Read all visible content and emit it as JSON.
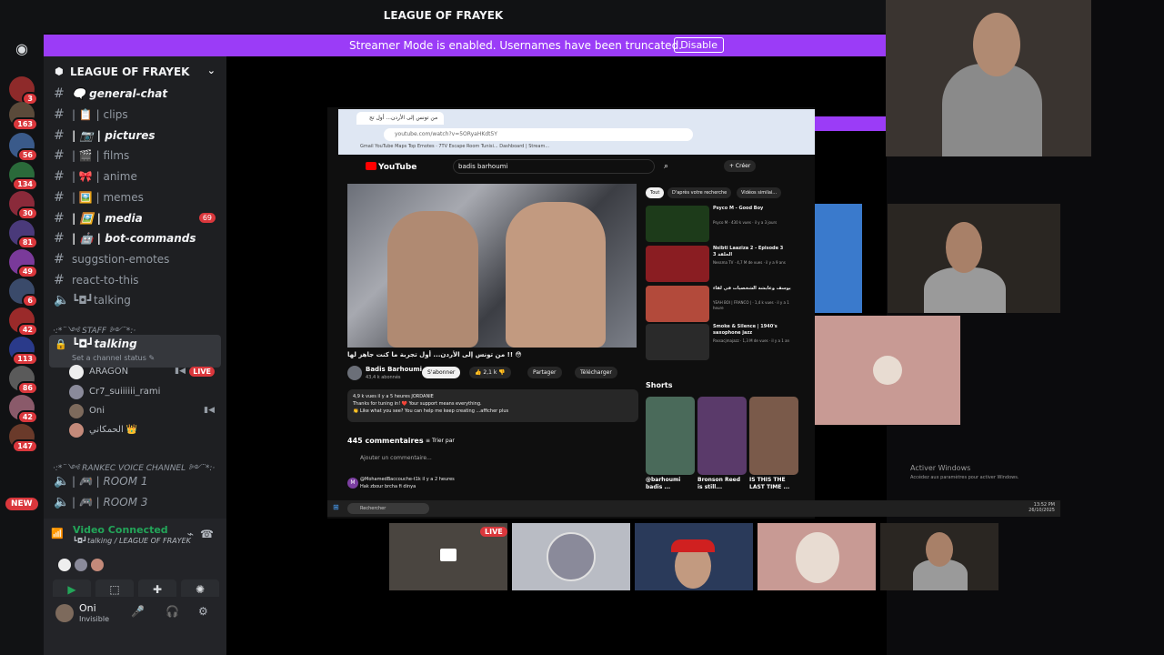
{
  "window": {
    "title": "LEAGUE OF FRAYEK"
  },
  "streamer_banner": {
    "message": "Streamer Mode is enabled. Usernames have been truncated.",
    "button": "Disable"
  },
  "rail": {
    "badges": [
      "3",
      "163",
      "56",
      "134",
      "30",
      "81",
      "49",
      "6",
      "42",
      "113",
      "86",
      "42",
      "147"
    ],
    "new_label": "NEW"
  },
  "server": {
    "name": "LEAGUE OF FRAYEK"
  },
  "channels": [
    {
      "name": "🗨️ general-chat",
      "bold": true
    },
    {
      "name": "| 📋 | clips",
      "bold": false
    },
    {
      "name": "| 📷 | pictures",
      "bold": true
    },
    {
      "name": "| 🎬 | films",
      "bold": false
    },
    {
      "name": "| 🎀 | anime",
      "bold": false
    },
    {
      "name": "| 🖼️ | memes",
      "bold": false
    },
    {
      "name": "| 🖼️ | media",
      "bold": true,
      "count": "69"
    },
    {
      "name": "| 🤖 | bot-commands",
      "bold": true
    },
    {
      "name": "suggstion-emotes",
      "bold": false
    },
    {
      "name": "react-to-this",
      "bold": false
    },
    {
      "name": "┗◘┛talking",
      "bold": false
    }
  ],
  "categories": {
    "staff": "·:*¨༺ STAFF ༻¨*:·",
    "voice": "·:*¨༺ RANKEC VOICE CHANNEL ༻¨*:·"
  },
  "selected_channel": {
    "name": "┗◘┛talking",
    "status": "Set a channel status ✎"
  },
  "voice_users": [
    {
      "name": "ARAGON",
      "live": "LIVE"
    },
    {
      "name": "Cr7_suiiiiii_rami"
    },
    {
      "name": "Oni"
    },
    {
      "name": "الحمكاني 👑"
    }
  ],
  "voice_channels": [
    "| 🎮 | ROOM 1",
    "| 🎮 | ROOM 3"
  ],
  "voice_connection": {
    "status": "Video Connected",
    "channel": "┗◘┛talking / LEAGUE OF FRAYEK"
  },
  "me": {
    "name": "Oni",
    "status": "Invisible"
  },
  "browser": {
    "tab_title": "من تونس إلى الأردن... أول تج",
    "url": "youtube.com/watch?v=5ORyaHKdt5Y",
    "bookmarks": "Gmail    YouTube    Maps    Top Emotes · 7TV    Escape Room Tunisi...    Dashboard | Stream..."
  },
  "youtube": {
    "search_query": "badis barhoumi",
    "create": "+ Créer",
    "video_title": "من تونس إلى الأردن... أول تجربة ما كنت جاهز لها !! 😳",
    "channel_name": "Badis Barhoumi",
    "channel_subs": "43,4 k abonnés",
    "subscribe": "S'abonner",
    "likes": "2,1 k",
    "share": "Partager",
    "download": "Télécharger",
    "description_line1": "4,9 k vues  il y a 5 heures  JORDANIE",
    "description_line2": "Thanks for tuning in! ❤️ Your support means everything.",
    "description_line3": "👏 Like what you see? You can help me keep creating ...afficher plus",
    "comments_count": "445 commentaires",
    "sort": "Trier par",
    "add_comment": "Ajouter un commentaire...",
    "comment_author": "@MohamedBaccouche-t1k  il y a 2 heures",
    "comment_text": "Hak zbour brcha fi dinya",
    "chips": [
      "Tout",
      "D'après votre recherche",
      "Vidéos similai..."
    ],
    "recommendations": [
      {
        "title": "Psyco M - Good Boy",
        "meta": "Psyco M · 430 k vues · il y a 3 jours",
        "color": "#1d3b1a"
      },
      {
        "title": "Nsibti Laaziza 2 - Episode 3 الحلقة 3",
        "meta": "Nessma TV · 4,7 M de vues · il y a 9 ans",
        "color": "#8a1d22"
      },
      {
        "title": "يوسف وعايشة الشخصيات في لقاء",
        "meta": "YEAH BOI | FRANCO | · 1,4 k vues · il y a 1 heure",
        "color": "#b34a3b"
      },
      {
        "title": "Smoke & Silence  |  1940's saxophone jazz",
        "meta": "Passacjmajazz · 1,3 M de vues · il y a 1 an",
        "color": "#2a2a2a"
      }
    ],
    "shorts_label": "Shorts",
    "shorts": [
      "@barhoumi badis ...",
      "Bronson Reed is still...",
      "IS THIS THE LAST TIME ..."
    ]
  },
  "taskbar": {
    "search": "Rechercher",
    "time": "13:52 PM",
    "date": "26/10/2025"
  },
  "activate_windows": {
    "title": "Activer Windows",
    "sub": "Accédez aux paramètres pour activer Windows."
  },
  "bottom_live": "LIVE"
}
